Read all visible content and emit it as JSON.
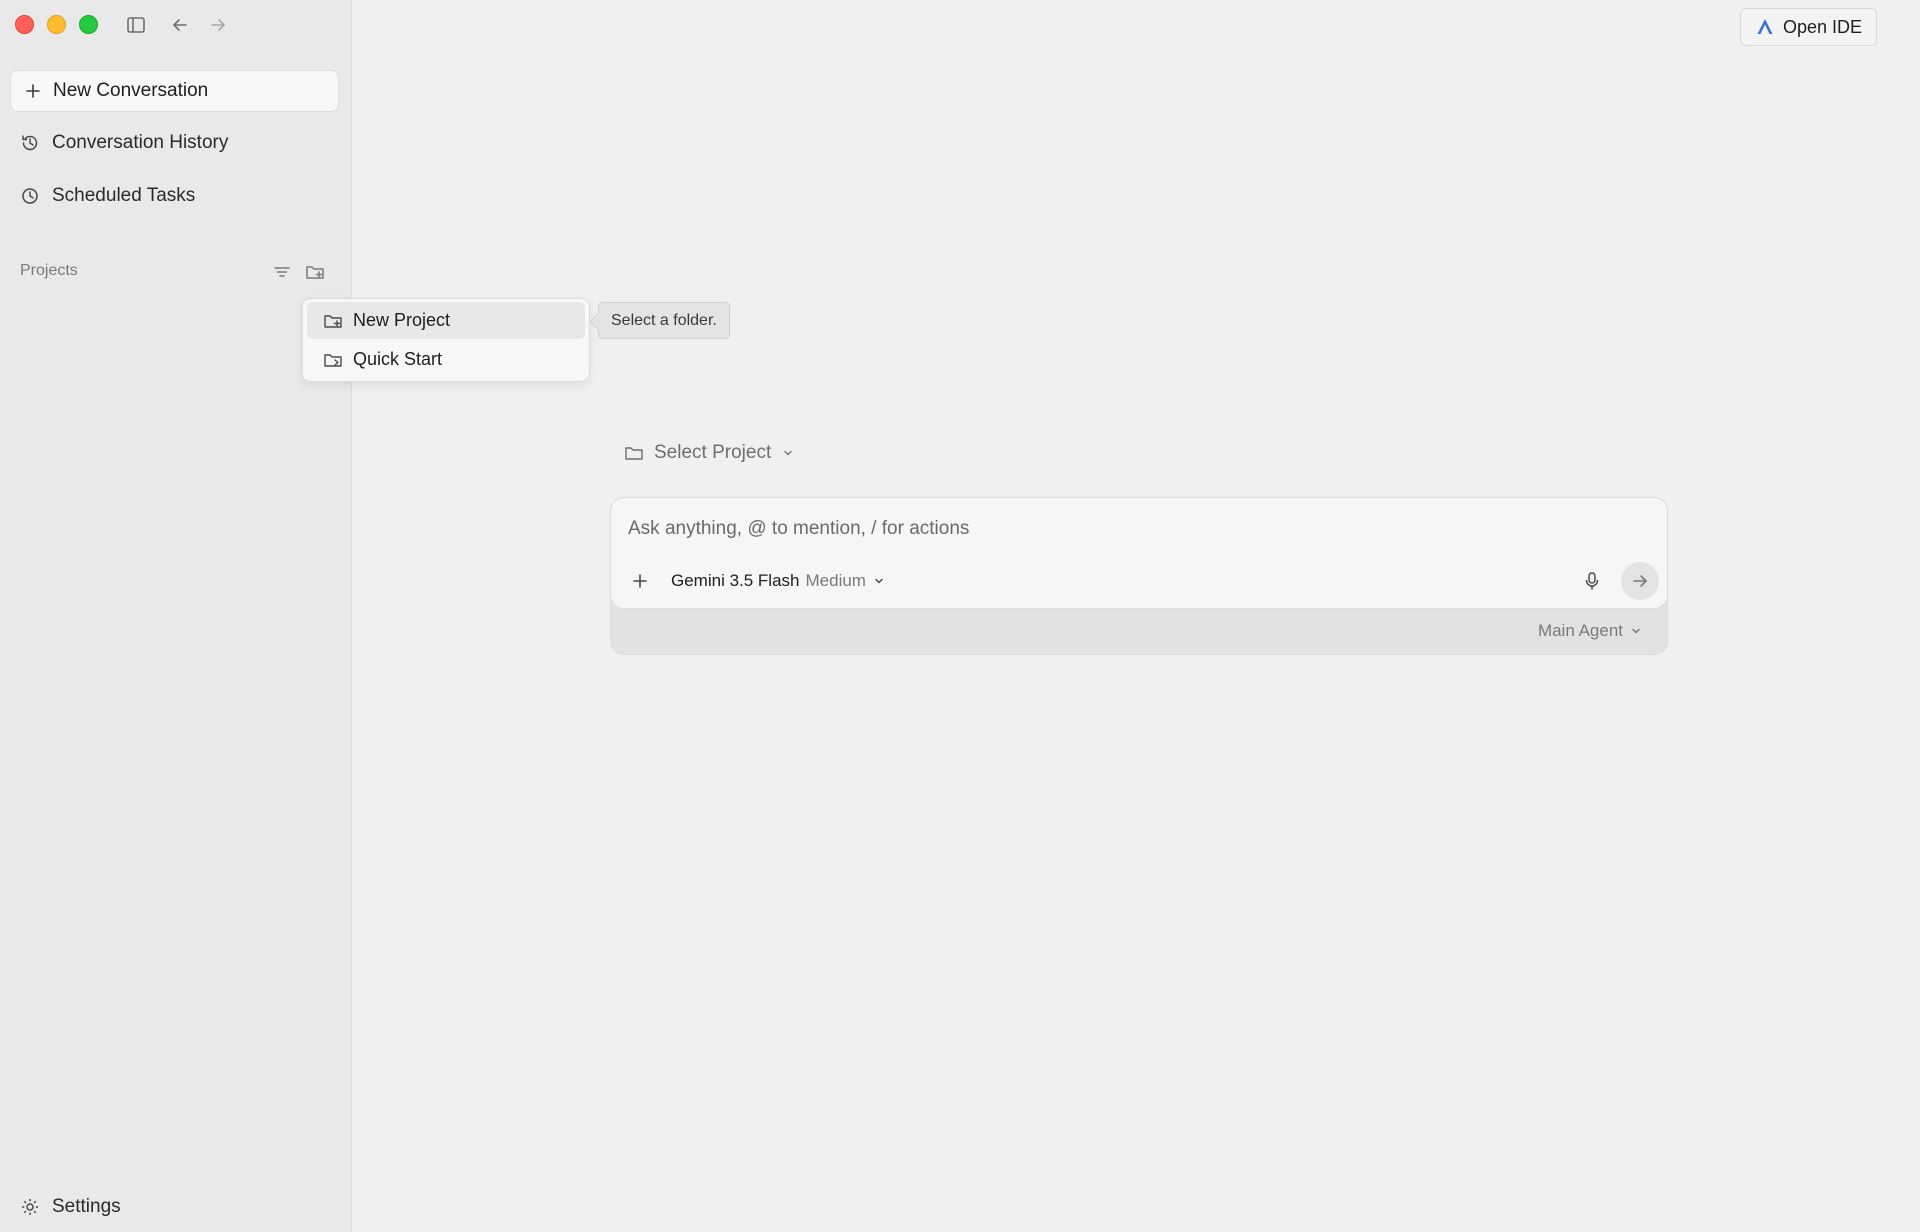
{
  "sidebar": {
    "new_conversation": "New Conversation",
    "nav": [
      {
        "label": "Conversation History",
        "icon": "history-icon"
      },
      {
        "label": "Scheduled Tasks",
        "icon": "clock-icon"
      }
    ],
    "projects_label": "Projects",
    "settings_label": "Settings"
  },
  "header": {
    "open_ide_label": "Open IDE"
  },
  "menu": {
    "items": [
      {
        "label": "New Project",
        "icon": "folder-plus-icon"
      },
      {
        "label": "Quick Start",
        "icon": "folder-arrow-icon"
      }
    ],
    "tooltip": "Select a folder."
  },
  "main": {
    "select_project": "Select Project",
    "composer": {
      "placeholder": "Ask anything, @ to mention, / for actions",
      "model_name": "Gemini 3.5 Flash",
      "model_effort": "Medium",
      "agent": "Main Agent"
    }
  },
  "colors": {
    "close": "#ff5f57",
    "minimize": "#febc2e",
    "maximize": "#28c840",
    "ide_logo": "#3b6fd6"
  }
}
